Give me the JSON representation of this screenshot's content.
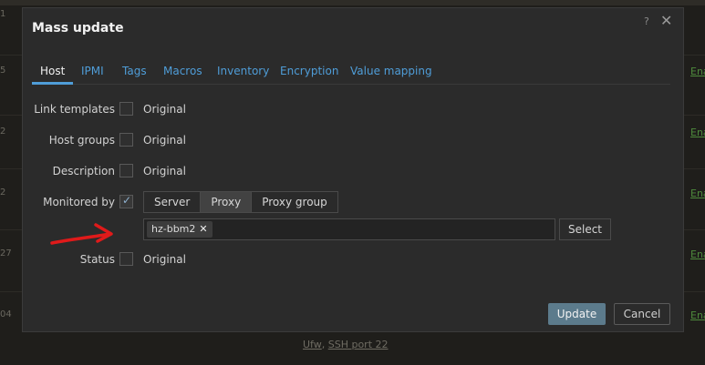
{
  "dialog": {
    "title": "Mass update",
    "help_icon": "?",
    "close_icon": "✕"
  },
  "tabs": [
    {
      "label": "Host",
      "active": true
    },
    {
      "label": "IPMI"
    },
    {
      "label": "Tags"
    },
    {
      "label": "Macros"
    },
    {
      "label": "Inventory"
    },
    {
      "label": "Encryption"
    },
    {
      "label": "Value mapping"
    }
  ],
  "rows": {
    "link_templates": {
      "label": "Link templates",
      "value": "Original",
      "checked": false
    },
    "host_groups": {
      "label": "Host groups",
      "value": "Original",
      "checked": false
    },
    "description": {
      "label": "Description",
      "value": "Original",
      "checked": false
    },
    "monitored_by": {
      "label": "Monitored by",
      "checked": true,
      "options": [
        "Server",
        "Proxy",
        "Proxy group"
      ],
      "selected": "Proxy"
    },
    "status": {
      "label": "Status",
      "value": "Original",
      "checked": false
    }
  },
  "proxy_field": {
    "chip": "hz-bbm2",
    "chip_remove": "✕",
    "select_label": "Select"
  },
  "footer": {
    "update_label": "Update",
    "cancel_label": "Cancel"
  },
  "background": {
    "row_numbers": [
      "1",
      "5",
      "2",
      "2",
      "27",
      "04"
    ],
    "enabled_label": "Ena",
    "bottom_text_1": "Ufw",
    "bottom_text_2": "SSH port 22"
  },
  "colors": {
    "accent_link": "#4f9dd8",
    "update_button": "#5c7b8c",
    "annotation_arrow": "#e01a1a"
  }
}
